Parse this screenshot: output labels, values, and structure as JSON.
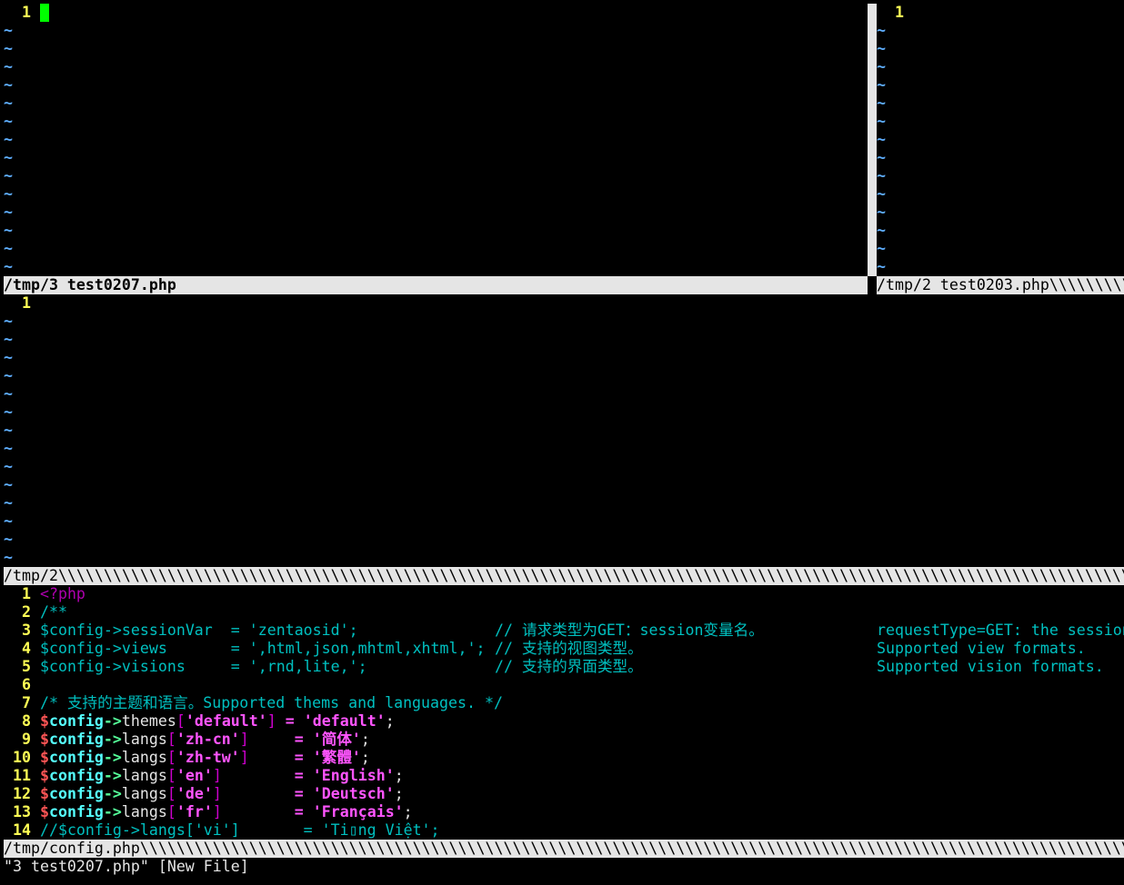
{
  "windows": {
    "top_left": {
      "status": "/tmp/3 test0207.php",
      "line_number": "1",
      "tilde_count": 14
    },
    "top_right": {
      "status": "/tmp/2 test0203.php",
      "status_fill": "\\",
      "line_number": "1",
      "tilde_count": 14
    },
    "middle": {
      "status": "/tmp/2",
      "status_fill": "\\",
      "line_number": "1",
      "tilde_count": 14
    },
    "bottom": {
      "status": "/tmp/config.php",
      "status_fill": "\\",
      "lines": [
        {
          "n": "1",
          "segs": [
            {
              "t": "<?php",
              "c": "pre"
            }
          ]
        },
        {
          "n": "2",
          "segs": [
            {
              "t": "/**",
              "c": "com"
            }
          ]
        },
        {
          "n": "3",
          "segs": [
            {
              "t": "$config->sessionVar  = 'zentaosid';",
              "c": "com"
            }
          ],
          "aside1": "// 请求类型为GET：session变量名。",
          "aside2": "requestType=GET: the session"
        },
        {
          "n": "4",
          "segs": [
            {
              "t": "$config->views       = ',html,json,mhtml,xhtml,';",
              "c": "com"
            }
          ],
          "aside1": "// 支持的视图类型。",
          "aside2": "Supported view formats."
        },
        {
          "n": "5",
          "segs": [
            {
              "t": "$config->visions     = ',rnd,lite,';",
              "c": "com"
            }
          ],
          "aside1": "// 支持的界面类型。",
          "aside2": "Supported vision formats."
        },
        {
          "n": "6",
          "segs": []
        },
        {
          "n": "7",
          "segs": [
            {
              "t": "/* 支持的主题和语言。Supported thems and languages. */",
              "c": "com"
            }
          ]
        },
        {
          "n": "8",
          "segs": [
            {
              "t": "$",
              "c": "dollar"
            },
            {
              "t": "config",
              "c": "var"
            },
            {
              "t": "->",
              "c": "arrow"
            },
            {
              "t": "themes",
              "c": "id"
            },
            {
              "t": "[",
              "c": "br"
            },
            {
              "t": "'default'",
              "c": "str"
            },
            {
              "t": "]",
              "c": "br"
            },
            {
              "t": " ",
              "c": "pl"
            },
            {
              "t": "=",
              "c": "op"
            },
            {
              "t": " ",
              "c": "pl"
            },
            {
              "t": "'default'",
              "c": "str"
            },
            {
              "t": ";",
              "c": "pl"
            }
          ]
        },
        {
          "n": "9",
          "segs": [
            {
              "t": "$",
              "c": "dollar"
            },
            {
              "t": "config",
              "c": "var"
            },
            {
              "t": "->",
              "c": "arrow"
            },
            {
              "t": "langs",
              "c": "id"
            },
            {
              "t": "[",
              "c": "br"
            },
            {
              "t": "'zh-cn'",
              "c": "str"
            },
            {
              "t": "]",
              "c": "br"
            },
            {
              "t": "     ",
              "c": "pl"
            },
            {
              "t": "=",
              "c": "op"
            },
            {
              "t": " ",
              "c": "pl"
            },
            {
              "t": "'简体'",
              "c": "str"
            },
            {
              "t": ";",
              "c": "pl"
            }
          ]
        },
        {
          "n": "10",
          "segs": [
            {
              "t": "$",
              "c": "dollar"
            },
            {
              "t": "config",
              "c": "var"
            },
            {
              "t": "->",
              "c": "arrow"
            },
            {
              "t": "langs",
              "c": "id"
            },
            {
              "t": "[",
              "c": "br"
            },
            {
              "t": "'zh-tw'",
              "c": "str"
            },
            {
              "t": "]",
              "c": "br"
            },
            {
              "t": "     ",
              "c": "pl"
            },
            {
              "t": "=",
              "c": "op"
            },
            {
              "t": " ",
              "c": "pl"
            },
            {
              "t": "'繁體'",
              "c": "str"
            },
            {
              "t": ";",
              "c": "pl"
            }
          ]
        },
        {
          "n": "11",
          "segs": [
            {
              "t": "$",
              "c": "dollar"
            },
            {
              "t": "config",
              "c": "var"
            },
            {
              "t": "->",
              "c": "arrow"
            },
            {
              "t": "langs",
              "c": "id"
            },
            {
              "t": "[",
              "c": "br"
            },
            {
              "t": "'en'",
              "c": "str"
            },
            {
              "t": "]",
              "c": "br"
            },
            {
              "t": "        ",
              "c": "pl"
            },
            {
              "t": "=",
              "c": "op"
            },
            {
              "t": " ",
              "c": "pl"
            },
            {
              "t": "'English'",
              "c": "str"
            },
            {
              "t": ";",
              "c": "pl"
            }
          ]
        },
        {
          "n": "12",
          "segs": [
            {
              "t": "$",
              "c": "dollar"
            },
            {
              "t": "config",
              "c": "var"
            },
            {
              "t": "->",
              "c": "arrow"
            },
            {
              "t": "langs",
              "c": "id"
            },
            {
              "t": "[",
              "c": "br"
            },
            {
              "t": "'de'",
              "c": "str"
            },
            {
              "t": "]",
              "c": "br"
            },
            {
              "t": "        ",
              "c": "pl"
            },
            {
              "t": "=",
              "c": "op"
            },
            {
              "t": " ",
              "c": "pl"
            },
            {
              "t": "'Deutsch'",
              "c": "str"
            },
            {
              "t": ";",
              "c": "pl"
            }
          ]
        },
        {
          "n": "13",
          "segs": [
            {
              "t": "$",
              "c": "dollar"
            },
            {
              "t": "config",
              "c": "var"
            },
            {
              "t": "->",
              "c": "arrow"
            },
            {
              "t": "langs",
              "c": "id"
            },
            {
              "t": "[",
              "c": "br"
            },
            {
              "t": "'fr'",
              "c": "str"
            },
            {
              "t": "]",
              "c": "br"
            },
            {
              "t": "        ",
              "c": "pl"
            },
            {
              "t": "=",
              "c": "op"
            },
            {
              "t": " ",
              "c": "pl"
            },
            {
              "t": "'Français'",
              "c": "str"
            },
            {
              "t": ";",
              "c": "pl"
            }
          ]
        },
        {
          "n": "14",
          "segs": [
            {
              "t": "//$config->langs['vi']       = 'Ti▯ng Việt';",
              "c": "com"
            }
          ]
        }
      ]
    }
  },
  "command_line": "\"3 test0207.php\" [New File]",
  "tilde_char": "~",
  "colors": {
    "line_number": "#ffff55",
    "tilde": "#5fafff",
    "comment": "#00c0c0",
    "string": "#ff55ff",
    "cursor": "#00ff00",
    "statusline_bg": "#e5e5e5"
  }
}
